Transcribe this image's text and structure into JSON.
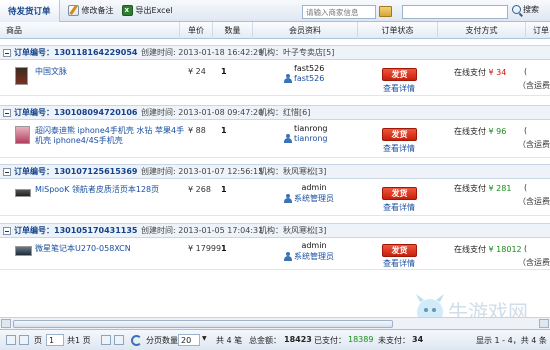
{
  "toolbar": {
    "tab_label": "待发货订单",
    "edit_label": "修改备注",
    "export_label": "导出Excel",
    "search_placeholder": "请输入商家信息",
    "search_label": "搜索"
  },
  "columns": [
    "商品",
    "单价",
    "数量",
    "会员资料",
    "订单状态",
    "支付方式",
    "订单"
  ],
  "orders": [
    {
      "order_no": "订单编号：130118164229054",
      "time": "创建时间: 2013-01-18 16:42:29",
      "org": "机构：叶子专卖店[5]",
      "product": "中国文脉",
      "product_line2": "",
      "price": "¥ 24",
      "qty": "1",
      "member_name": "fast526",
      "member_account": "fast526",
      "ship_label": "发货",
      "detail_label": "查看详情",
      "pay_method": "在线支付",
      "pay_amount": "¥ 34",
      "amount_color": "red",
      "extra": "(",
      "ship_fee": "（含运费"
    },
    {
      "order_no": "订单编号：130108094720106",
      "time": "创建时间: 2013-01-08 09:47:20",
      "org": "机构：红惜[6]",
      "product": "超闪泰迪熊 iphone4手机壳 水钻 苹果4手",
      "product_line2": "机壳 iphone4/4S手机壳",
      "price": "¥ 88",
      "qty": "1",
      "member_name": "tianrong",
      "member_account": "tianrong",
      "ship_label": "发货",
      "detail_label": "查看详情",
      "pay_method": "在线支付",
      "pay_amount": "¥ 96",
      "amount_color": "green",
      "extra": "(",
      "ship_fee": "（含运费"
    },
    {
      "order_no": "订单编号：130107125615369",
      "time": "创建时间: 2013-01-07 12:56:15",
      "org": "机构：秋风寒松[3]",
      "product": "MiSpooK 领航者皮质活页本128页",
      "product_line2": "",
      "price": "¥ 268",
      "qty": "1",
      "member_name": "admin",
      "member_account": "系统管理员",
      "ship_label": "发货",
      "detail_label": "查看详情",
      "pay_method": "在线支付",
      "pay_amount": "¥ 281",
      "amount_color": "green",
      "extra": "(",
      "ship_fee": "（含运费"
    },
    {
      "order_no": "订单编号：130105170431135",
      "time": "创建时间: 2013-01-05 17:04:31",
      "org": "机构：秋风寒松[3]",
      "product": "微星笔记本U270-058XCN",
      "product_line2": "",
      "price": "¥ 17999",
      "qty": "1",
      "member_name": "admin",
      "member_account": "系统管理员",
      "ship_label": "发货",
      "detail_label": "查看详情",
      "pay_method": "在线支付",
      "pay_amount": "¥ 18012",
      "amount_color": "green",
      "extra": "(",
      "ship_fee": "（含运费"
    }
  ],
  "pager": {
    "page_label": "页",
    "page_value": "1",
    "page_total": "共1 页",
    "page_size_label": "分页数量",
    "page_size_value": "20",
    "total_count": "共 4 笔",
    "total_amount_label": "总金额：",
    "total_amount": "18423",
    "paid_label": "已支付：",
    "paid_amount": "18389",
    "unpaid_label": "未支付：",
    "unpaid_amount": "34",
    "display_range": "显示 1 - 4，共 4 条"
  },
  "watermark": "牛游戏网"
}
